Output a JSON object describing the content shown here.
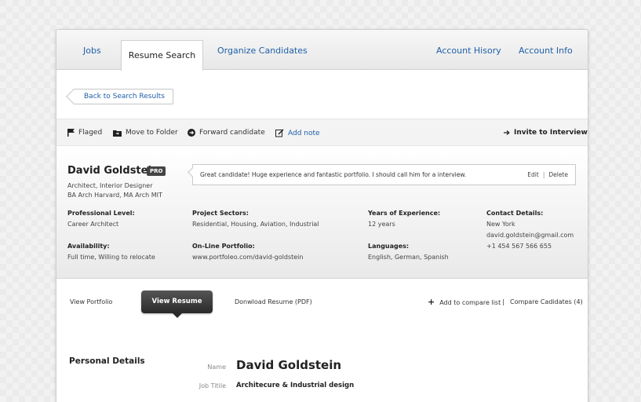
{
  "nav": {
    "jobs": "Jobs",
    "resume_search": "Resume Search",
    "organize": "Organize Candidates",
    "account_history": "Account Hisory",
    "account_info": "Account Info"
  },
  "back_button": "Back to Search Results",
  "actions": {
    "flagged": "Flaged",
    "move_to_folder": "Move to Folder",
    "forward": "Forward candidate",
    "add_note": "Add note",
    "invite": "Invite to Interview"
  },
  "candidate": {
    "name": "David Goldstein",
    "badge": "PRO",
    "title": "Architect, Interior Designer",
    "education": "BA Arch Harvard, MA Arch MIT",
    "note": "Great candidate! Huge experience and fantastic portfolio. I should call him for a interview.",
    "note_edit": "Edit",
    "note_sep": "|",
    "note_delete": "Delete",
    "professional_level_label": "Professional Level:",
    "professional_level": "Career Architect",
    "project_sectors_label": "Project Sectors:",
    "project_sectors": "Residential, Housing, Aviation, Industrial",
    "years_label": "Years of Experience:",
    "years": "12 years",
    "contact_label": "Contact Details:",
    "contact_city": "New York",
    "contact_email": "david.goldstein@gmail.com",
    "contact_phone": "+1 454 567 566 655",
    "availability_label": "Availability:",
    "availability": "Full time, Willing to relocate",
    "portfolio_label": "On-Line Portfolio:",
    "portfolio": "www.portfoleo.com/david-goldstein",
    "languages_label": "Languages:",
    "languages": "English, German, Spanish"
  },
  "resume_bar": {
    "view_portfolio": "View Portfolio",
    "view_resume": "View Resume",
    "download": "Donwload Resume (PDF)",
    "add_compare": "Add to compare list",
    "sep": "|",
    "compare": "Compare Cadidates (4)"
  },
  "personal_details": {
    "title": "Personal Details",
    "name_label": "Name",
    "name": "David Goldstein",
    "job_title_label": "Job Titile",
    "job_title": "Architecure & Industrial design"
  },
  "colors": {
    "link": "#1f5fa8",
    "dark_button": "#2a2a2a"
  }
}
